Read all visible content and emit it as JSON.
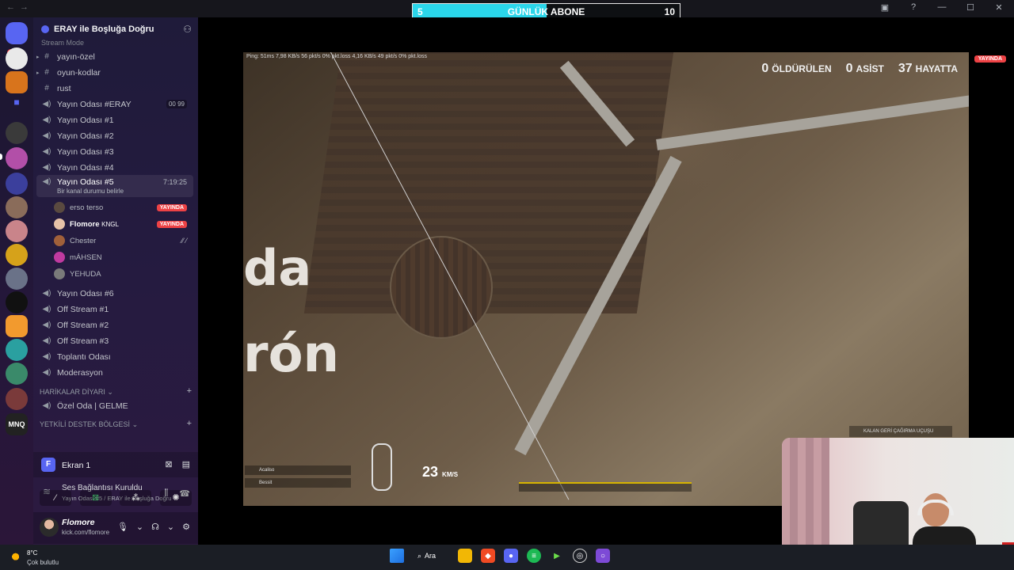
{
  "goal": {
    "left_value": "5",
    "title": "GÜNLÜK ABONE",
    "right_value": "10",
    "progress_fraction": 0.5,
    "fill_color": "#2ad6ea"
  },
  "rail": {
    "badge": "518"
  },
  "server": {
    "name": "ERAY ile Boşluğa Doğru",
    "mode_label": "Stream Mode"
  },
  "channels": [
    {
      "type": "text",
      "label": "yayın-özel"
    },
    {
      "type": "text",
      "label": "oyun-kodlar"
    },
    {
      "type": "text",
      "label": "rust"
    },
    {
      "type": "voice",
      "label": "Yayın Odası #ERAY",
      "mini": "00 99"
    },
    {
      "type": "voice",
      "label": "Yayın Odası #1"
    },
    {
      "type": "voice",
      "label": "Yayın Odası #2"
    },
    {
      "type": "voice",
      "label": "Yayın Odası #3"
    },
    {
      "type": "voice",
      "label": "Yayın Odası #4"
    },
    {
      "type": "voice",
      "label": "Yayın Odası #5",
      "time": "7:19:25",
      "status": "Bir kanal durumu belirle"
    }
  ],
  "voice_users": [
    {
      "name": "erso terso",
      "badge": "YAYINDA"
    },
    {
      "name": "Flomore",
      "tag": "KNGL",
      "badge": "YAYINDA"
    },
    {
      "name": "Chester"
    },
    {
      "name": "mÁHSEN"
    },
    {
      "name": "YEHUDA"
    }
  ],
  "channels_after": [
    {
      "label": "Yayın Odası #6"
    },
    {
      "label": "Off Stream #1"
    },
    {
      "label": "Off Stream #2"
    },
    {
      "label": "Off Stream #3"
    },
    {
      "label": "Toplantı Odası"
    },
    {
      "label": "Moderasyon"
    }
  ],
  "categories": [
    {
      "label": "HARİKALAR DİYARI"
    },
    {
      "label": "YETKİLİ DESTEK BÖLGESİ"
    }
  ],
  "special_channel": {
    "label": "Özel Oda | GELME"
  },
  "screen_share": {
    "icon_letter": "F",
    "title": "Ekran 1"
  },
  "voice_status": {
    "title": "Ses Bağlantısı Kuruldu",
    "subtitle": "Yayın Odası #5 / ERAY ile Boşluğa Doğru"
  },
  "user": {
    "name": "Flomore",
    "sub": "kick.com/flomore"
  },
  "game": {
    "kills_value": "0",
    "kills_label": "ÖLDÜRÜLEN",
    "assists_value": "0",
    "assists_label": "ASİST",
    "alive_value": "37",
    "alive_label": "HAYATTA",
    "net": "Ping: 51ms   7,98 KB/s   56 pkt/s   0% pkt.loss   4,16 KB/s   49 pkt/s   0% pkt.loss",
    "map_text_1": "da",
    "map_text_2": "rón",
    "speed_value": "23",
    "speed_unit": "KM/S",
    "recall": "KALAN GERİ ÇAĞIRMA UÇUŞU",
    "team_1": "Acaliso",
    "team_2": "Bessit",
    "live_tag": "YAYINDA"
  },
  "taskbar": {
    "temp": "8°C",
    "weather": "Çok bulutlu",
    "search_label": "Ara"
  }
}
